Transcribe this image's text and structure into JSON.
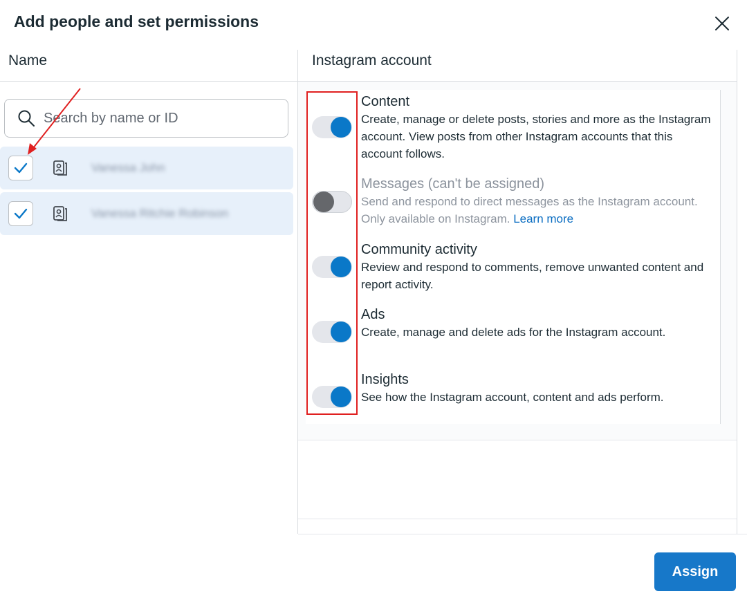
{
  "dialog": {
    "title": "Add people and set permissions",
    "close_icon": "close-icon"
  },
  "columns": {
    "name": "Name",
    "account": "Instagram account"
  },
  "search": {
    "placeholder": "Search by name or ID",
    "value": ""
  },
  "people": [
    {
      "name": "Vanessa John",
      "checked": true,
      "icon": "person-card-icon"
    },
    {
      "name": "Vanessa Ritchie Robinson",
      "checked": true,
      "icon": "person-card-icon"
    }
  ],
  "permissions": [
    {
      "title": "Content",
      "description": "Create, manage or delete posts, stories and more as the Instagram account. View posts from other Instagram accounts that this account follows.",
      "enabled": true
    },
    {
      "title": "Messages (can't be assigned)",
      "description": "Send and respond to direct messages as the Instagram account. Only available on Instagram.",
      "link": "Learn more",
      "enabled": false
    },
    {
      "title": "Community activity",
      "description": "Review and respond to comments, remove unwanted content and report activity.",
      "enabled": true
    },
    {
      "title": "Ads",
      "description": "Create, manage and delete ads for the Instagram account.",
      "enabled": true
    },
    {
      "title": "Insights",
      "description": "See how the Instagram account, content and ads perform.",
      "enabled": true
    }
  ],
  "footer": {
    "assign_label": "Assign"
  },
  "colors": {
    "accent": "#1778c9",
    "toggle_on": "#0a78c8",
    "selected_row": "#e7f0fa",
    "annotation": "#e02020"
  }
}
